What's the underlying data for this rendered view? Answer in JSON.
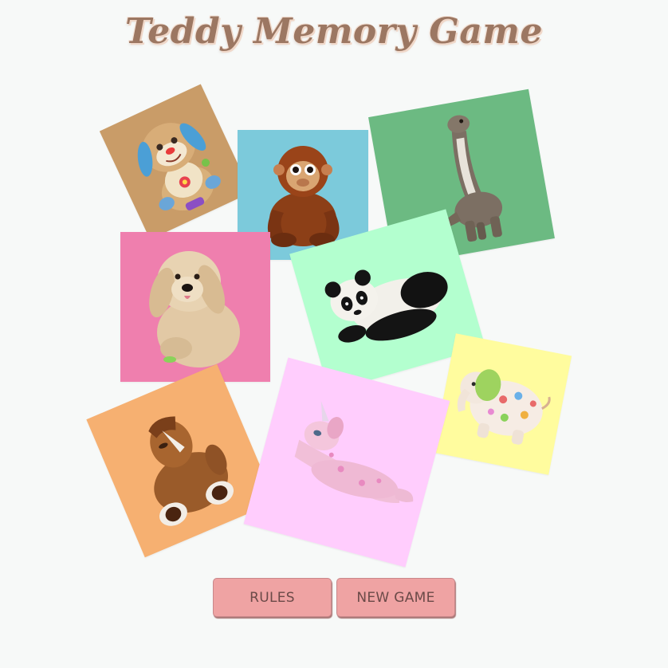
{
  "game": {
    "title": "Teddy Memory Game"
  },
  "cards": [
    {
      "name": "card-dog",
      "icon": "teddy-dog-icon",
      "color": "#c99c68"
    },
    {
      "name": "card-monkey",
      "icon": "teddy-monkey-icon",
      "color": "#7ccadb"
    },
    {
      "name": "card-dinosaur",
      "icon": "teddy-dinosaur-icon",
      "color": "#6cba82"
    },
    {
      "name": "card-puppy",
      "icon": "teddy-puppy-icon",
      "color": "#ef7fae"
    },
    {
      "name": "card-panda",
      "icon": "teddy-panda-icon",
      "color": "#b3ffcf"
    },
    {
      "name": "card-elephant",
      "icon": "teddy-elephant-icon",
      "color": "#fffc9e"
    },
    {
      "name": "card-horse",
      "icon": "teddy-horse-icon",
      "color": "#f6b071"
    },
    {
      "name": "card-unicorn",
      "icon": "teddy-unicorn-icon",
      "color": "#ffcdfd"
    }
  ],
  "controls": {
    "rules_label": "RULES",
    "new_game_label": "NEW GAME"
  },
  "colors": {
    "background": "#f7f9f8",
    "title": "#9c7762",
    "button": "#efa3a3"
  }
}
